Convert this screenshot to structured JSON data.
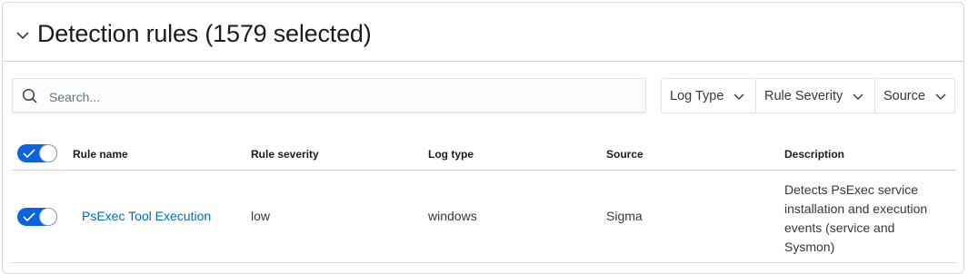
{
  "panel": {
    "title": "Detection rules (1579 selected)"
  },
  "search": {
    "placeholder": "Search..."
  },
  "filters": [
    {
      "label": "Log Type"
    },
    {
      "label": "Rule Severity"
    },
    {
      "label": "Source"
    }
  ],
  "table": {
    "columns": [
      "Rule name",
      "Rule severity",
      "Log type",
      "Source",
      "Description"
    ],
    "rows": [
      {
        "enabled": true,
        "rule_name": "PsExec Tool Execution",
        "rule_severity": "low",
        "log_type": "windows",
        "source": "Sigma",
        "description": "Detects PsExec service installation and execution events (service and Sysmon)"
      }
    ]
  },
  "colors": {
    "accent": "#0b64dd",
    "link": "#006bb8",
    "border": "#d3dae6"
  },
  "icons": {
    "collapse": "chevron-down-icon",
    "search": "search-icon",
    "filter": "chevron-down-icon",
    "switch": "check-icon"
  }
}
